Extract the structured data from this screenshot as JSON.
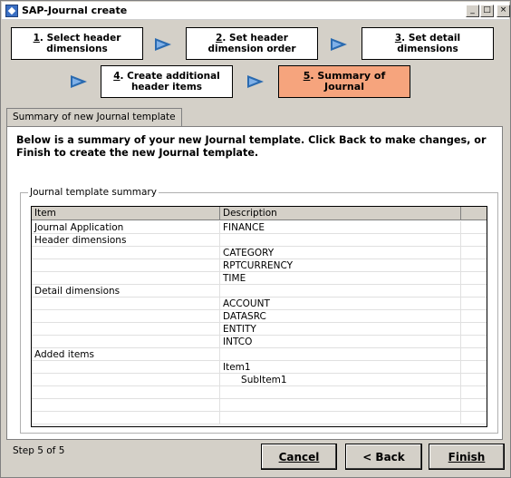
{
  "window": {
    "title": "SAP-Journal create"
  },
  "steps": [
    {
      "num": "1",
      "label": ". Select header dimensions"
    },
    {
      "num": "2",
      "label": ". Set header dimension order"
    },
    {
      "num": "3",
      "label": ". Set detail dimensions"
    },
    {
      "num": "4",
      "label": ". Create additional header items"
    },
    {
      "num": "5",
      "label": ". Summary of Journal"
    }
  ],
  "tab": {
    "label": "Summary of new Journal template"
  },
  "intro": "Below is a summary of your new Journal template. Click Back to make changes, or Finish to create the new Journal template.",
  "group": {
    "label": "Journal template summary"
  },
  "grid": {
    "headers": [
      "Item",
      "Description",
      ""
    ],
    "rows": [
      {
        "item": "Journal Application",
        "desc": "FINANCE"
      },
      {
        "item": "Header dimensions",
        "desc": ""
      },
      {
        "item": "",
        "desc": "CATEGORY"
      },
      {
        "item": "",
        "desc": "RPTCURRENCY"
      },
      {
        "item": "",
        "desc": "TIME"
      },
      {
        "item": "Detail dimensions",
        "desc": ""
      },
      {
        "item": "",
        "desc": "ACCOUNT"
      },
      {
        "item": "",
        "desc": "DATASRC"
      },
      {
        "item": "",
        "desc": "ENTITY"
      },
      {
        "item": "",
        "desc": "INTCO"
      },
      {
        "item": "Added items",
        "desc": ""
      },
      {
        "item": "",
        "desc": "Item1"
      },
      {
        "item": "",
        "desc": "      SubItem1"
      },
      {
        "item": "",
        "desc": ""
      },
      {
        "item": "",
        "desc": ""
      },
      {
        "item": "",
        "desc": ""
      }
    ]
  },
  "footer": {
    "step_text": "Step 5 of 5"
  },
  "buttons": {
    "cancel": "Cancel",
    "back": "< Back",
    "finish": "Finish"
  },
  "colors": {
    "active_step": "#f6a47d",
    "arrow": "#2a6ab0"
  }
}
